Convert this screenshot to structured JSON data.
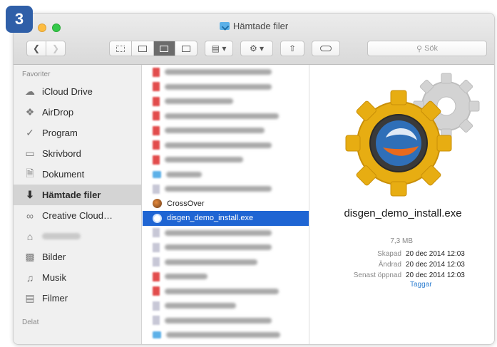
{
  "step_badge": "3",
  "window": {
    "title": "Hämtade filer",
    "search_placeholder": "Sök"
  },
  "sidebar": {
    "favorites_header": "Favoriter",
    "shared_header": "Delat",
    "items": [
      {
        "label": "iCloud Drive",
        "icon": "cloud-icon"
      },
      {
        "label": "AirDrop",
        "icon": "airdrop-icon"
      },
      {
        "label": "Program",
        "icon": "applications-icon"
      },
      {
        "label": "Skrivbord",
        "icon": "desktop-icon"
      },
      {
        "label": "Dokument",
        "icon": "document-icon"
      },
      {
        "label": "Hämtade filer",
        "icon": "downloads-icon",
        "selected": true
      },
      {
        "label": "Creative Cloud…",
        "icon": "creative-cloud-icon"
      },
      {
        "label": "",
        "icon": "home-icon"
      },
      {
        "label": "Bilder",
        "icon": "pictures-icon"
      },
      {
        "label": "Musik",
        "icon": "music-icon"
      },
      {
        "label": "Filmer",
        "icon": "movies-icon"
      }
    ]
  },
  "files": {
    "crossover": "CrossOver",
    "selected": "disgen_demo_install.exe"
  },
  "preview": {
    "name": "disgen_demo_install.exe",
    "size": "7,3 MB",
    "created_label": "Skapad",
    "created_value": "20 dec 2014 12:03",
    "modified_label": "Ändrad",
    "modified_value": "20 dec 2014 12:03",
    "opened_label": "Senast öppnad",
    "opened_value": "20 dec 2014 12:03",
    "tags_link": "Taggar"
  },
  "colors": {
    "selection": "#1f65d3",
    "badge": "#2f5fa8",
    "gear_gold": "#e7ad12",
    "link": "#2f7fd1"
  }
}
